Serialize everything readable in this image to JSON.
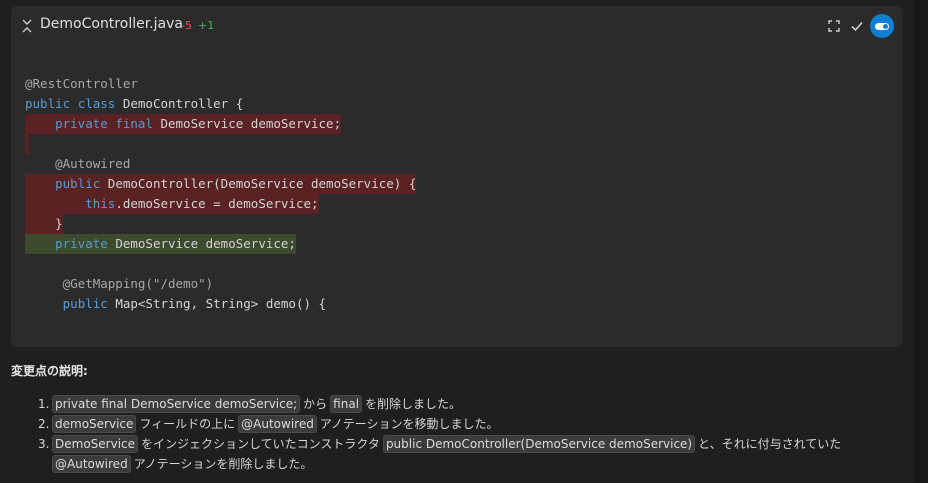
{
  "header": {
    "file_name": "DemoController.java",
    "deletions": "-5",
    "additions": "+1",
    "colors": {
      "accent": "#0e7fd2",
      "deleted": "#f14c4c",
      "added": "#3fb950"
    }
  },
  "code": {
    "lines": [
      {
        "parts": [
          {
            "t": "@RestController",
            "c": "ann"
          }
        ],
        "type": "ctx"
      },
      {
        "parts": [
          {
            "t": "public ",
            "c": "kw"
          },
          {
            "t": "class ",
            "c": "kw"
          },
          {
            "t": "DemoController {",
            "c": "plain"
          }
        ],
        "type": "ctx"
      },
      {
        "parts": [
          {
            "t": "    ",
            "c": "plain"
          },
          {
            "t": "private ",
            "c": "kw"
          },
          {
            "t": "final ",
            "c": "kw"
          },
          {
            "t": "DemoService demoService;",
            "c": "plain"
          }
        ],
        "type": "del"
      },
      {
        "parts": [
          {
            "t": "",
            "c": "plain"
          }
        ],
        "type": "del-empty"
      },
      {
        "parts": [
          {
            "t": "    @Autowired",
            "c": "ann"
          }
        ],
        "type": "ctx"
      },
      {
        "parts": [
          {
            "t": "    ",
            "c": "plain"
          },
          {
            "t": "public ",
            "c": "kw"
          },
          {
            "t": "DemoController(DemoService demoService) {",
            "c": "plain"
          }
        ],
        "type": "del"
      },
      {
        "parts": [
          {
            "t": "        ",
            "c": "plain"
          },
          {
            "t": "this",
            "c": "kw"
          },
          {
            "t": ".demoService = demoService;",
            "c": "plain"
          }
        ],
        "type": "del"
      },
      {
        "parts": [
          {
            "t": "    }",
            "c": "plain"
          }
        ],
        "type": "del"
      },
      {
        "parts": [
          {
            "t": "    ",
            "c": "plain"
          },
          {
            "t": "private ",
            "c": "kw"
          },
          {
            "t": "DemoService demoService;",
            "c": "plain"
          }
        ],
        "type": "add"
      },
      {
        "parts": [
          {
            "t": "",
            "c": "plain"
          }
        ],
        "type": "ctx"
      },
      {
        "parts": [
          {
            "t": "     @GetMapping(\"/demo\")",
            "c": "ann"
          }
        ],
        "type": "ctx"
      },
      {
        "parts": [
          {
            "t": "     ",
            "c": "plain"
          },
          {
            "t": "public ",
            "c": "kw"
          },
          {
            "t": "Map<String, String> demo() {",
            "c": "plain"
          }
        ],
        "type": "ctx"
      }
    ]
  },
  "explanation": {
    "heading": "変更点の説明:",
    "items": [
      {
        "num": "1.",
        "parts": [
          {
            "chip": "private final DemoService demoService;"
          },
          {
            "text": "から"
          },
          {
            "chip": "final"
          },
          {
            "text": "を削除しました。"
          }
        ]
      },
      {
        "num": "2.",
        "parts": [
          {
            "chip": "demoService"
          },
          {
            "text": "フィールドの上に"
          },
          {
            "chip": "@Autowired"
          },
          {
            "text": "アノテーションを移動しました。"
          }
        ]
      },
      {
        "num": "3.",
        "parts": [
          {
            "chip": "DemoService"
          },
          {
            "text": "をインジェクションしていたコンストラクタ"
          },
          {
            "chip": "public DemoController(DemoService demoService)"
          },
          {
            "text": "と、それに付与されていた"
          }
        ]
      },
      {
        "num": "",
        "parts": [
          {
            "chip": "@Autowired"
          },
          {
            "text": "アノテーションを削除しました。"
          }
        ]
      }
    ]
  }
}
